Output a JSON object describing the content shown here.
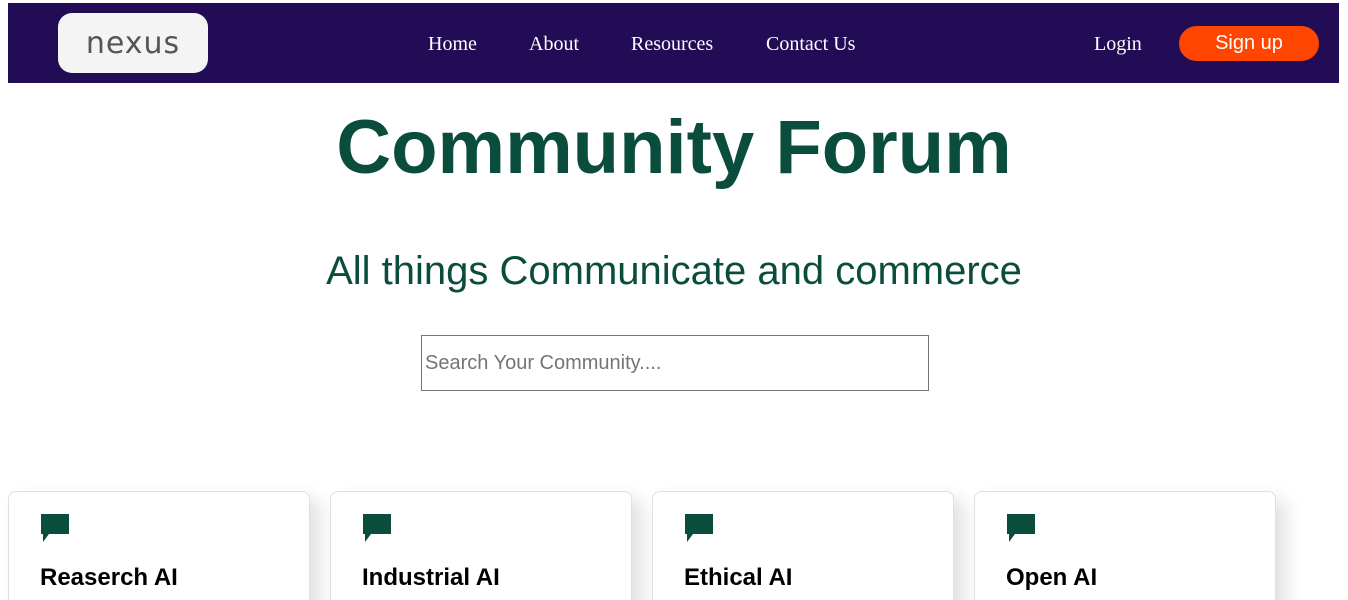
{
  "header": {
    "logo_text": "nexus",
    "nav": [
      "Home",
      "About",
      "Resources",
      "Contact Us"
    ],
    "login_label": "Login",
    "signup_label": "Sign up"
  },
  "main": {
    "title": "Community Forum",
    "subtitle": "All things Communicate and commerce",
    "search_placeholder": "Search Your Community...."
  },
  "cards": [
    {
      "title": "Reaserch AI",
      "icon": "comment-icon"
    },
    {
      "title": "Industrial AI",
      "icon": "comment-icon"
    },
    {
      "title": "Ethical AI",
      "icon": "comment-icon"
    },
    {
      "title": "Open AI",
      "icon": "comment-icon"
    }
  ],
  "colors": {
    "navbar": "#220c55",
    "accent": "#ff4500",
    "heading": "#0a4d3c"
  }
}
